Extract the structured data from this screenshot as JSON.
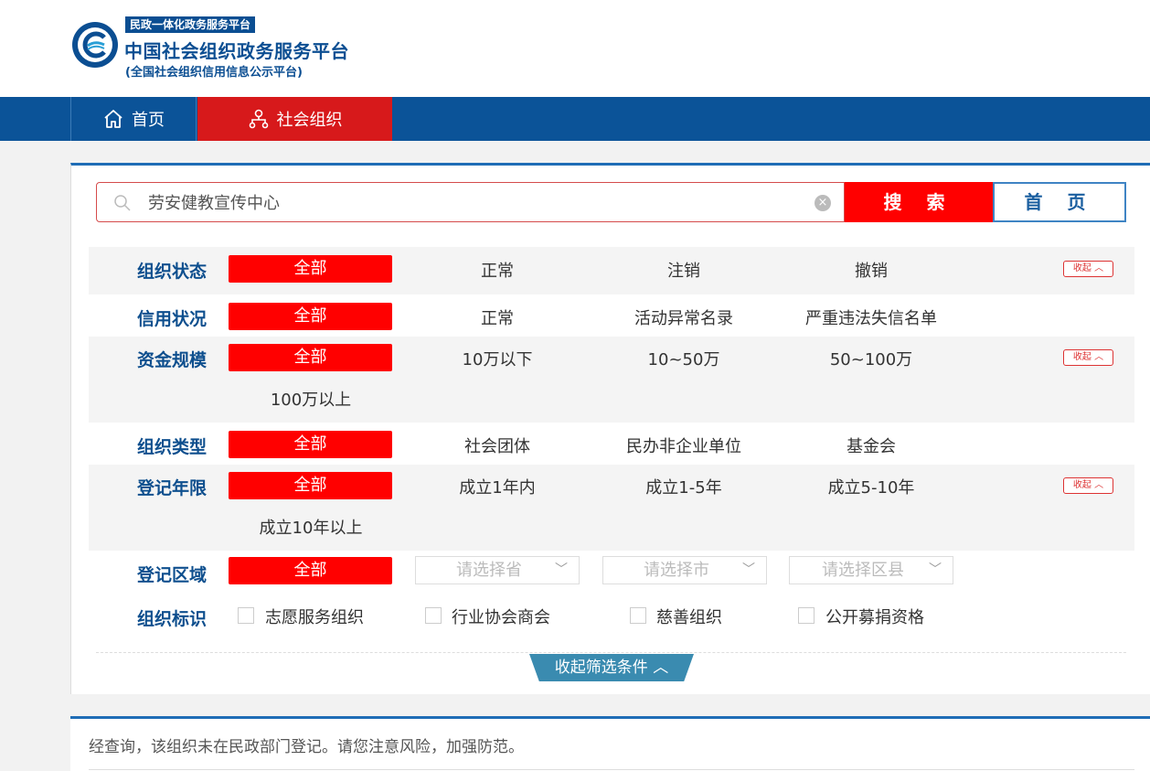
{
  "header": {
    "badge": "民政一体化政务服务平台",
    "title": "中国社会组织政务服务平台",
    "subtitle": "(全国社会组织信用信息公示平台)"
  },
  "nav": {
    "home": "首页",
    "social_org": "社会组织"
  },
  "search": {
    "value": "劳安健教宣传中心",
    "search_button": "搜 索",
    "home_button": "首 页"
  },
  "filters": {
    "all_label": "全部",
    "collapse_label": "收起",
    "status": {
      "label": "组织状态",
      "options": [
        "正常",
        "注销",
        "撤销"
      ]
    },
    "credit": {
      "label": "信用状况",
      "options": [
        "正常",
        "活动异常名录",
        "严重违法失信名单"
      ]
    },
    "capital": {
      "label": "资金规模",
      "options": [
        "10万以下",
        "10~50万",
        "50~100万",
        "100万以上"
      ]
    },
    "type": {
      "label": "组织类型",
      "options": [
        "社会团体",
        "民办非企业单位",
        "基金会"
      ]
    },
    "years": {
      "label": "登记年限",
      "options": [
        "成立1年内",
        "成立1-5年",
        "成立5-10年",
        "成立10年以上"
      ]
    },
    "region": {
      "label": "登记区域",
      "province": "请选择省",
      "city": "请选择市",
      "district": "请选择区县"
    },
    "marks": {
      "label": "组织标识",
      "options": [
        "志愿服务组织",
        "行业协会商会",
        "慈善组织",
        "公开募捐资格"
      ]
    }
  },
  "toggle_label": "收起筛选条件",
  "result": {
    "message": "经查询，该组织未在民政部门登记。请您注意风险，加强防范。"
  },
  "colors": {
    "primary_blue": "#0b5398",
    "accent_red": "#ff0000",
    "nav_active": "#d7191b",
    "label_blue": "#0e4f8e"
  }
}
